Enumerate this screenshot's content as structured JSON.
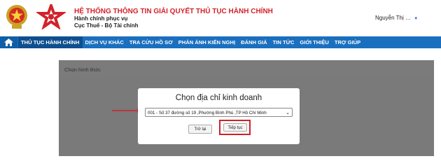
{
  "header": {
    "system_title": "HỆ THỐNG THÔNG TIN GIẢI QUYẾT THỦ TỤC HÀNH CHÍNH",
    "subtitle_1": "Hành chính phục vụ",
    "subtitle_2": "Cục Thuế - Bộ Tài chính",
    "user_name": "Nguyễn Thị …"
  },
  "nav": {
    "items": [
      {
        "label": "THỦ TỤC HÀNH CHÍNH"
      },
      {
        "label": "DỊCH VỤ KHÁC"
      },
      {
        "label": "TRA CỨU HỒ SƠ"
      },
      {
        "label": "PHẢN ÁNH KIẾN NGHỊ"
      },
      {
        "label": "ĐÁNH GIÁ"
      },
      {
        "label": "TIN TỨC"
      },
      {
        "label": "GIỚI THIỆU"
      },
      {
        "label": "TRỢ GIÚP"
      }
    ]
  },
  "panel": {
    "label": "Chọn hình thức"
  },
  "modal": {
    "title": "Chọn địa chỉ kinh doanh",
    "select_value": "001 - Số 37 đường số 19 ,Phường Bình Phú ,TP Hồ Chí Minh",
    "back_label": "Trở lại",
    "next_label": "Tiếp tục"
  },
  "colors": {
    "brand_red": "#d3222a",
    "nav_blue": "#1a6fbf",
    "nav_active": "#0e4f8f",
    "overlay_gray": "#7a7a7a",
    "highlight_red": "#d0202a"
  }
}
